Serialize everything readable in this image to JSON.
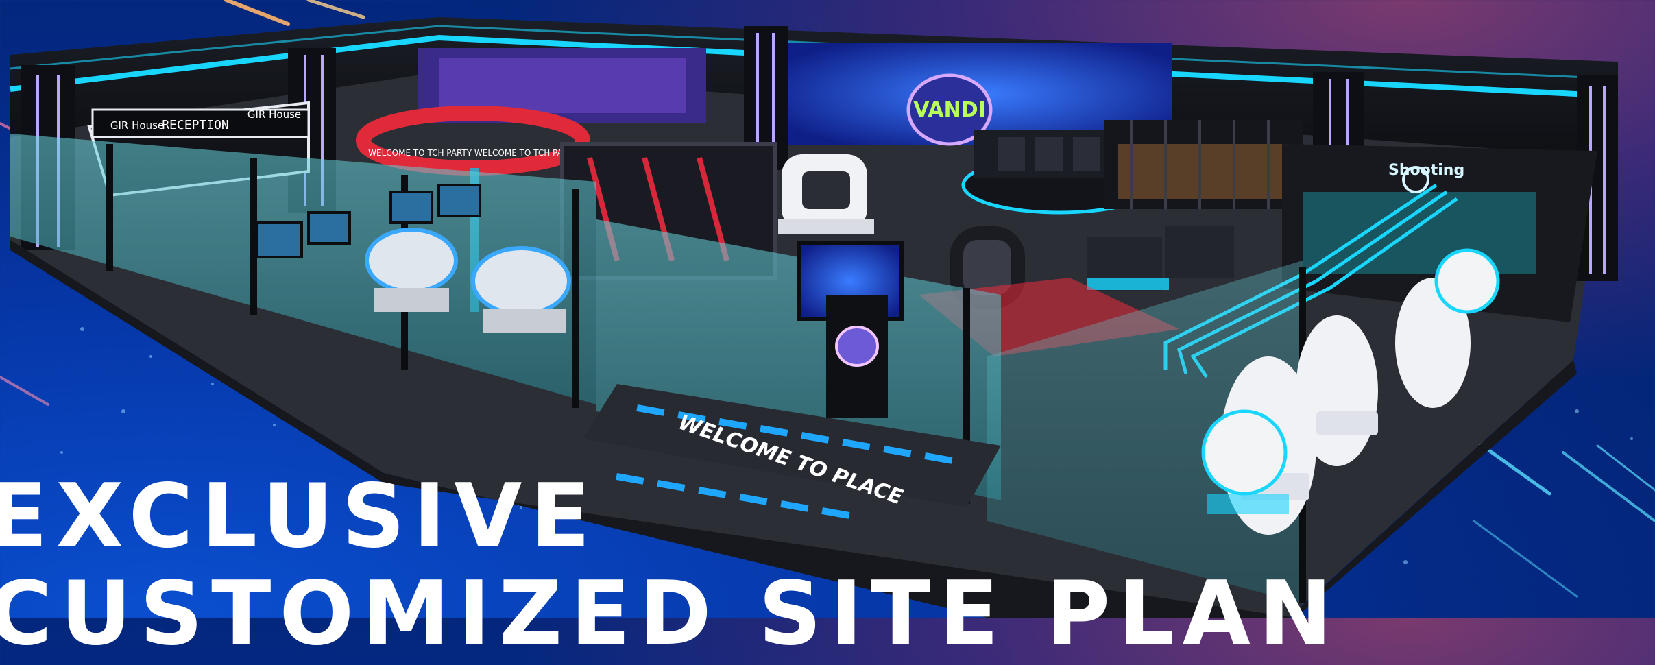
{
  "headline": {
    "line1": "EXCLUSIVE",
    "line2": "CUSTOMIZED SITE PLAN"
  },
  "signage": {
    "reception_sign": "RECEPTION",
    "brand_logo_left": "GIR House",
    "brand_logo_right": "GIR House",
    "ring_banner": "WELCOME TO TCH PARTY WELCOME TO TCH PARTY",
    "center_screen_logo": "VANDI",
    "floor_text": "WELCOME TO PLACE",
    "shooting_zone_sign": "Shooting"
  },
  "colors": {
    "background_deep": "#042a86",
    "background_glow": "#0a4fd0",
    "neon_cyan": "#19d6ff",
    "neon_red": "#ff2a3a",
    "wall_dark": "#15171c",
    "floor_dark": "#2b2e35",
    "headline": "#ffffff"
  }
}
